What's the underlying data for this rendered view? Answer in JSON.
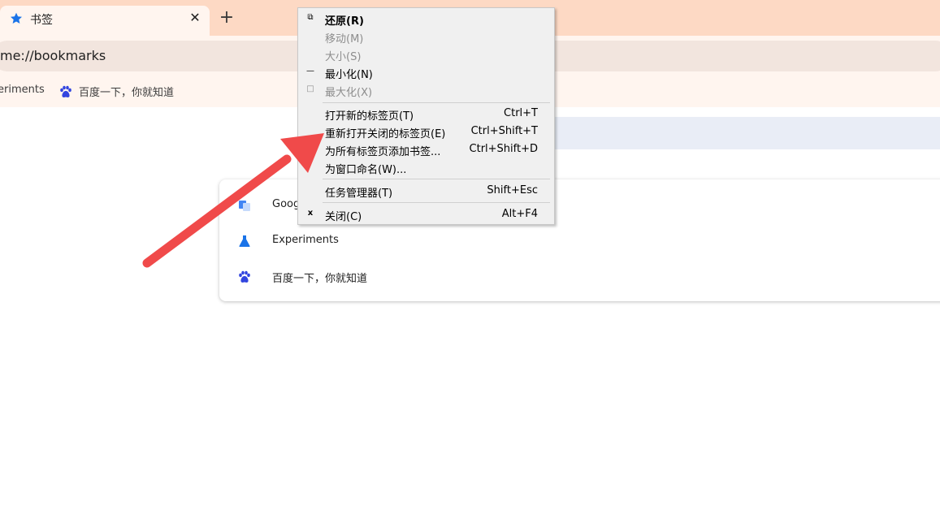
{
  "tab": {
    "title": "书签",
    "favicon": "star-icon",
    "close_icon": "close-icon"
  },
  "new_tab": {
    "label": "+"
  },
  "omnibox": {
    "url": "me://bookmarks"
  },
  "bookmarks_bar": {
    "items": [
      {
        "label": "eriments",
        "icon": "flask-icon"
      },
      {
        "label": "百度一下，你就知道",
        "icon": "baidu-paw-icon"
      }
    ]
  },
  "bookmark_list": {
    "items": [
      {
        "label": "Goog",
        "icon": "google-translate-icon"
      },
      {
        "label": "Experiments",
        "icon": "flask-icon"
      },
      {
        "label": "百度一下，你就知道",
        "icon": "baidu-paw-icon"
      }
    ]
  },
  "context_menu": {
    "items": [
      {
        "mark": "⧉",
        "label": "还原(R)",
        "shortcut": "",
        "state": "bold"
      },
      {
        "mark": "",
        "label": "移动(M)",
        "shortcut": "",
        "state": "disabled"
      },
      {
        "mark": "",
        "label": "大小(S)",
        "shortcut": "",
        "state": "disabled"
      },
      {
        "mark": "—",
        "label": "最小化(N)",
        "shortcut": "",
        "state": "normal"
      },
      {
        "mark": "□",
        "label": "最大化(X)",
        "shortcut": "",
        "state": "disabled"
      },
      {
        "mark": "",
        "label": "打开新的标签页(T)",
        "shortcut": "Ctrl+T",
        "state": "normal"
      },
      {
        "mark": "",
        "label": "重新打开关闭的标签页(E)",
        "shortcut": "Ctrl+Shift+T",
        "state": "normal"
      },
      {
        "mark": "",
        "label": "为所有标签页添加书签...",
        "shortcut": "Ctrl+Shift+D",
        "state": "normal"
      },
      {
        "mark": "",
        "label": "为窗口命名(W)...",
        "shortcut": "",
        "state": "normal"
      },
      {
        "mark": "",
        "label": "任务管理器(T)",
        "shortcut": "Shift+Esc",
        "state": "normal"
      },
      {
        "mark": "x",
        "label": "关闭(C)",
        "shortcut": "Alt+F4",
        "state": "normal"
      }
    ]
  },
  "colors": {
    "tabstrip": "#fdd9c4",
    "toolbar": "#fff5ef",
    "menu_bg": "#f0f0f0",
    "arrow": "#f04a4a",
    "accent_blue": "#1a73e8"
  }
}
